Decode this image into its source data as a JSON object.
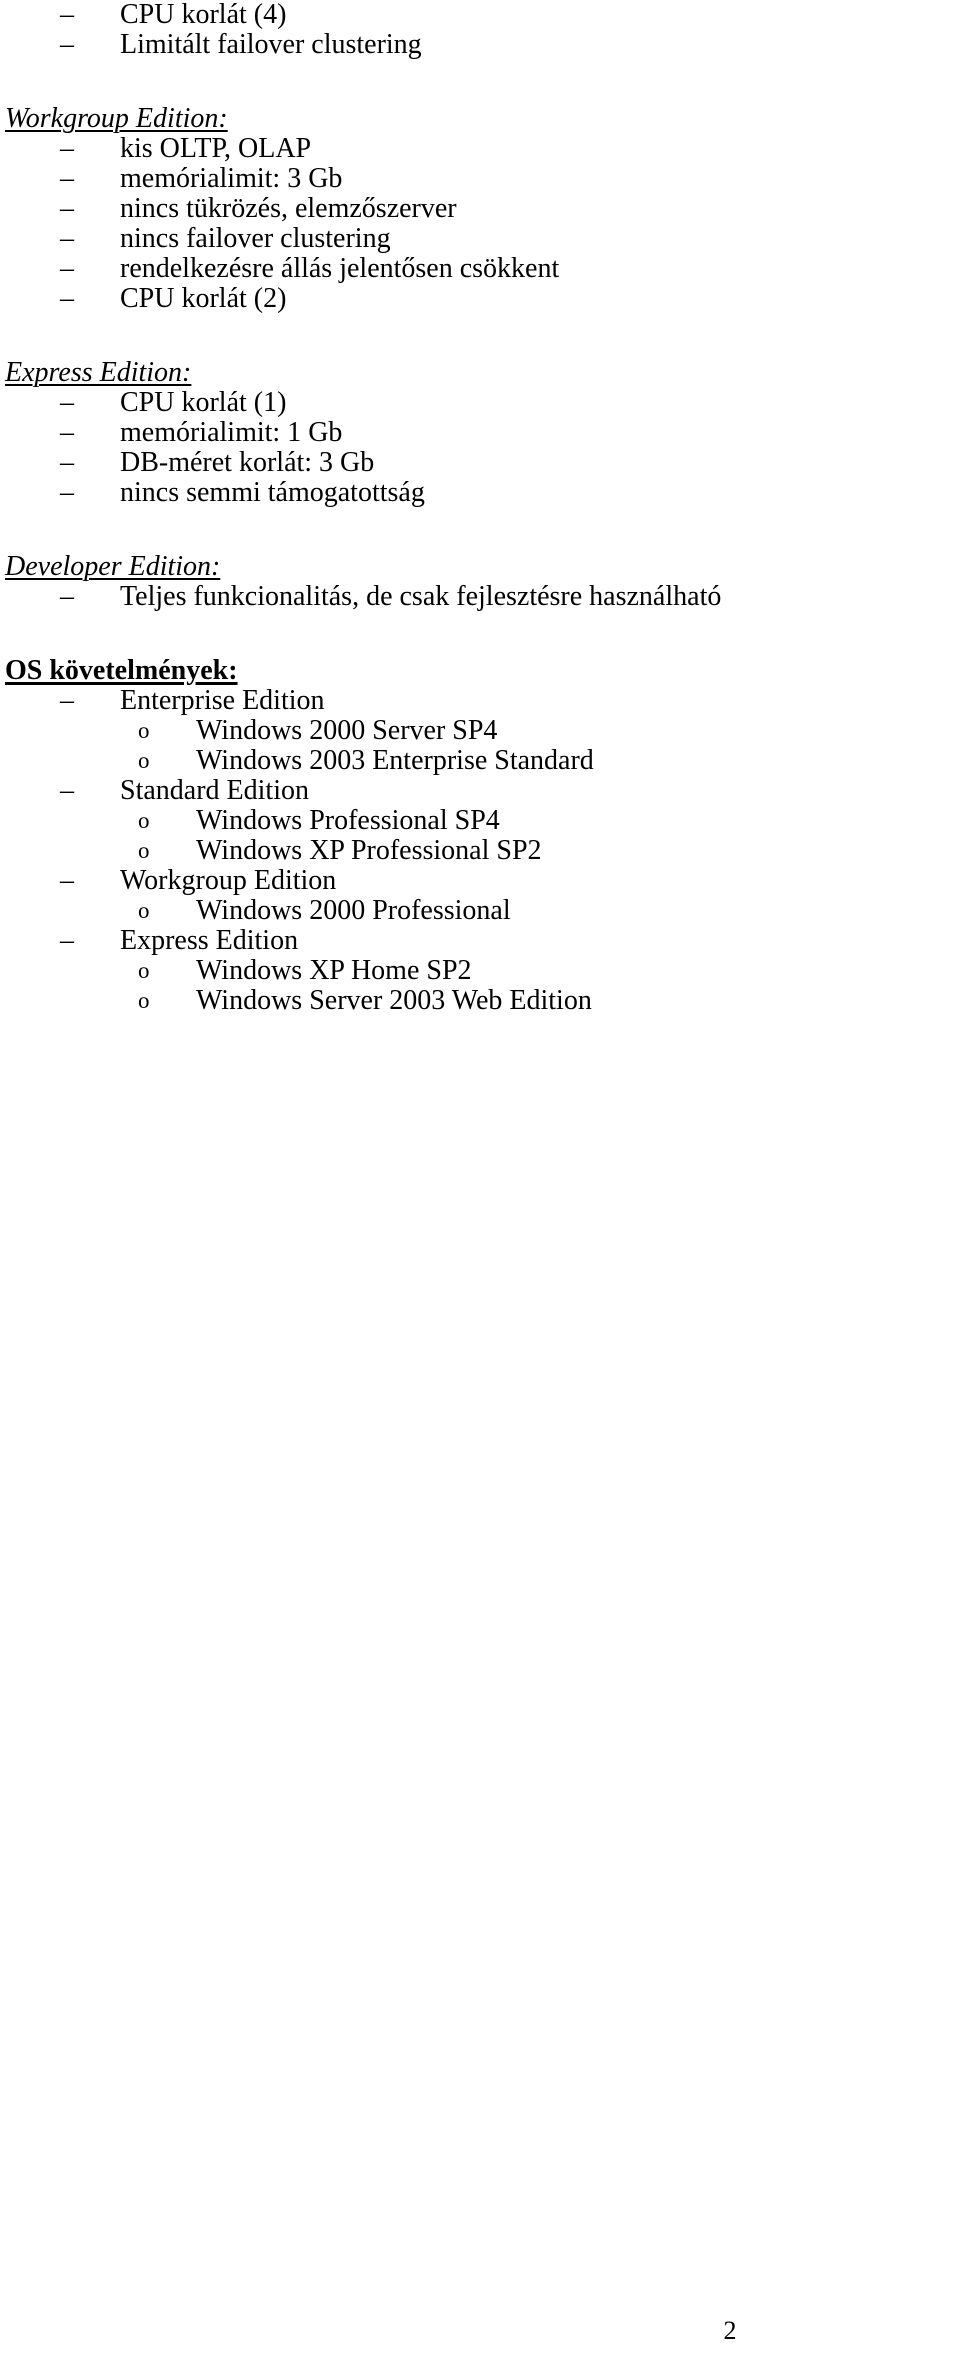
{
  "document": {
    "page_number": "2",
    "bullet_marker_dash": "–",
    "bullet_marker_circle": "o"
  },
  "blocks": [
    {
      "type": "bullet1",
      "text": "CPU korlát (4)"
    },
    {
      "type": "bullet1",
      "text": "Limitált failover clustering"
    },
    {
      "type": "heading-italic",
      "text": "Workgroup Edition:"
    },
    {
      "type": "bullet1",
      "text": "kis OLTP, OLAP"
    },
    {
      "type": "bullet1",
      "text": "memórialimit: 3 Gb"
    },
    {
      "type": "bullet1",
      "text": "nincs tükrözés, elemzőszerver"
    },
    {
      "type": "bullet1",
      "text": "nincs failover clustering"
    },
    {
      "type": "bullet1",
      "text": "rendelkezésre állás jelentősen csökkent"
    },
    {
      "type": "bullet1",
      "text": "CPU korlát (2)"
    },
    {
      "type": "heading-italic",
      "text": "Express Edition:"
    },
    {
      "type": "bullet1",
      "text": "CPU korlát (1)"
    },
    {
      "type": "bullet1",
      "text": "memórialimit: 1 Gb"
    },
    {
      "type": "bullet1",
      "text": "DB-méret korlát: 3 Gb"
    },
    {
      "type": "bullet1",
      "text": "nincs semmi támogatottság"
    },
    {
      "type": "heading-italic",
      "text": "Developer Edition:"
    },
    {
      "type": "bullet1",
      "text": "Teljes funkcionalitás, de csak fejlesztésre használható"
    },
    {
      "type": "heading-bold",
      "text": "OS követelmények:"
    },
    {
      "type": "bullet1",
      "text": "Enterprise Edition"
    },
    {
      "type": "bullet2",
      "text": "Windows 2000 Server SP4"
    },
    {
      "type": "bullet2",
      "text": "Windows 2003 Enterprise Standard"
    },
    {
      "type": "bullet1",
      "text": "Standard Edition"
    },
    {
      "type": "bullet2",
      "text": "Windows Professional SP4"
    },
    {
      "type": "bullet2",
      "text": "Windows XP Professional SP2"
    },
    {
      "type": "bullet1",
      "text": "Workgroup Edition"
    },
    {
      "type": "bullet2",
      "text": "Windows 2000 Professional"
    },
    {
      "type": "bullet1",
      "text": "Express Edition"
    },
    {
      "type": "bullet2",
      "text": "Windows XP Home SP2"
    },
    {
      "type": "bullet2",
      "text": "Windows Server 2003 Web Edition"
    }
  ]
}
